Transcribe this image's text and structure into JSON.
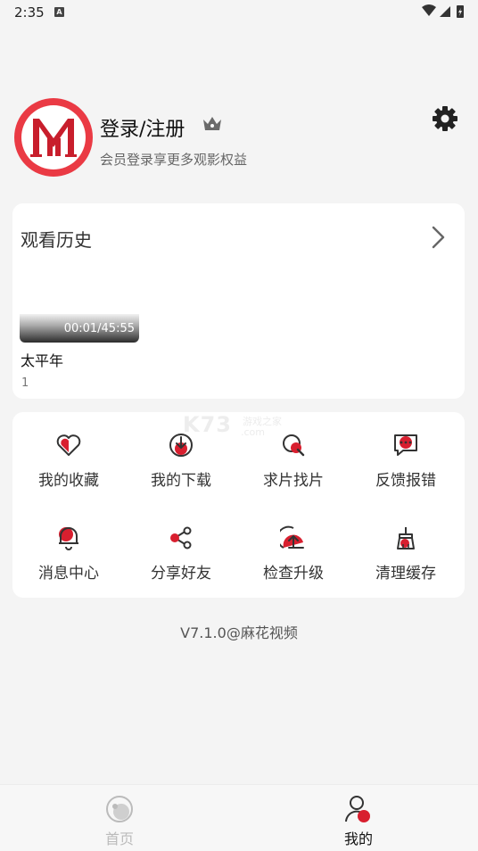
{
  "status_bar": {
    "time": "2:35",
    "badge": "A"
  },
  "profile": {
    "logo_name": "M-logo",
    "title": "登录/注册",
    "subtitle": "会员登录享更多观影权益"
  },
  "history": {
    "title": "观看历史",
    "items": [
      {
        "progress": "00:01/45:55",
        "title": "太平年",
        "episode": "1"
      }
    ]
  },
  "menu": {
    "items": [
      {
        "label": "我的收藏",
        "icon": "heart-icon"
      },
      {
        "label": "我的下载",
        "icon": "download-icon"
      },
      {
        "label": "求片找片",
        "icon": "search-icon"
      },
      {
        "label": "反馈报错",
        "icon": "feedback-icon"
      },
      {
        "label": "消息中心",
        "icon": "bell-icon"
      },
      {
        "label": "分享好友",
        "icon": "share-icon"
      },
      {
        "label": "检查升级",
        "icon": "upgrade-icon"
      },
      {
        "label": "清理缓存",
        "icon": "broom-icon"
      }
    ]
  },
  "watermark": {
    "main": "K73",
    "sub1": "游戏之家",
    "sub2": ".com"
  },
  "version": "V7.1.0@麻花视频",
  "bottom_nav": {
    "items": [
      {
        "label": "首页",
        "icon": "home-icon",
        "active": false
      },
      {
        "label": "我的",
        "icon": "user-icon",
        "active": true
      }
    ]
  },
  "colors": {
    "accent": "#d81f2f",
    "background": "#f4f4f4",
    "card": "#ffffff"
  }
}
